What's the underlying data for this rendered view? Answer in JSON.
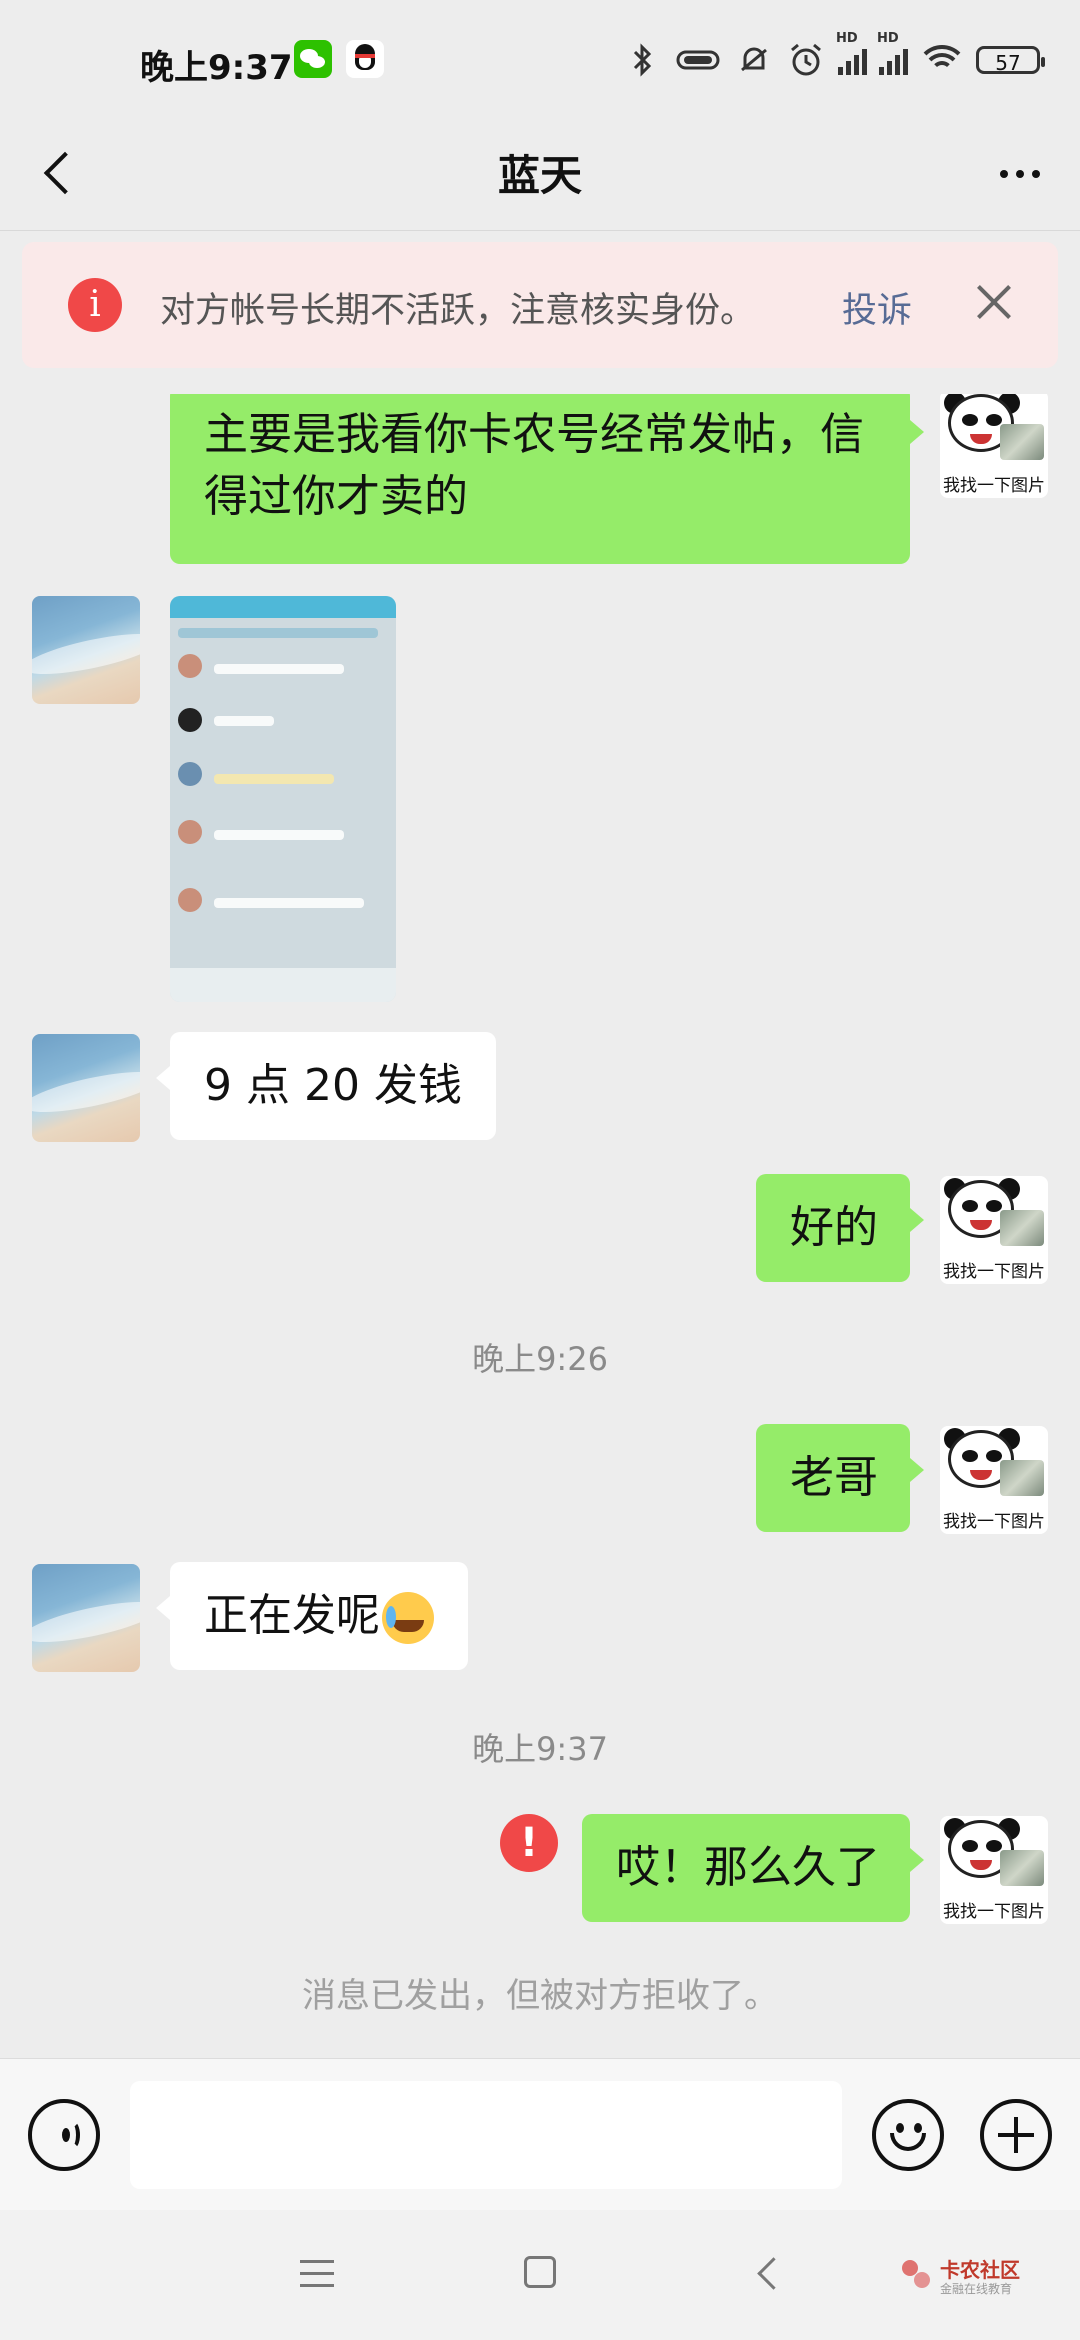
{
  "status_bar": {
    "time": "晚上9:37",
    "battery": "57",
    "icons": [
      "wechat-icon",
      "qq-icon",
      "bluetooth-icon",
      "vibrate-icon",
      "mute-icon",
      "alarm-icon",
      "signal-hd-icon",
      "signal-hd-icon",
      "wifi-icon",
      "battery-icon"
    ]
  },
  "nav": {
    "title": "蓝天",
    "back_icon": "chevron-left-icon",
    "more_icon": "more-dots-icon"
  },
  "banner": {
    "text": "对方帐号长期不活跃，注意核实身份。",
    "link": "投诉",
    "icon": "info-icon",
    "close_icon": "close-icon",
    "accent": "#f04848",
    "link_color": "#576b95"
  },
  "chat": {
    "sticker_caption": "我找一下图片",
    "messages": [
      {
        "from": "me",
        "type": "text",
        "text": "主要是我看你卡农号经常发帖，信得过你才卖的"
      },
      {
        "from": "them",
        "type": "image"
      },
      {
        "from": "them",
        "type": "text",
        "text": "9 点 20 发钱"
      },
      {
        "from": "me",
        "type": "text",
        "text": "好的"
      },
      {
        "type": "timestamp",
        "text": "晚上9:26"
      },
      {
        "from": "me",
        "type": "text",
        "text": "老哥"
      },
      {
        "from": "them",
        "type": "text",
        "text": "正在发呢",
        "emoji": "crying-laughing-emoji"
      },
      {
        "type": "timestamp",
        "text": "晚上9:37"
      },
      {
        "from": "me",
        "type": "text",
        "text": "哎！那么久了",
        "status": "failed"
      },
      {
        "type": "system",
        "text": "消息已发出，但被对方拒收了。"
      }
    ],
    "bubble_green": "#95ec69",
    "bubble_white": "#ffffff"
  },
  "input_bar": {
    "value": "",
    "icons": [
      "voice-icon",
      "emoji-icon",
      "plus-icon"
    ]
  },
  "watermark": {
    "title": "卡农社区",
    "subtitle": "金融在线教育"
  }
}
